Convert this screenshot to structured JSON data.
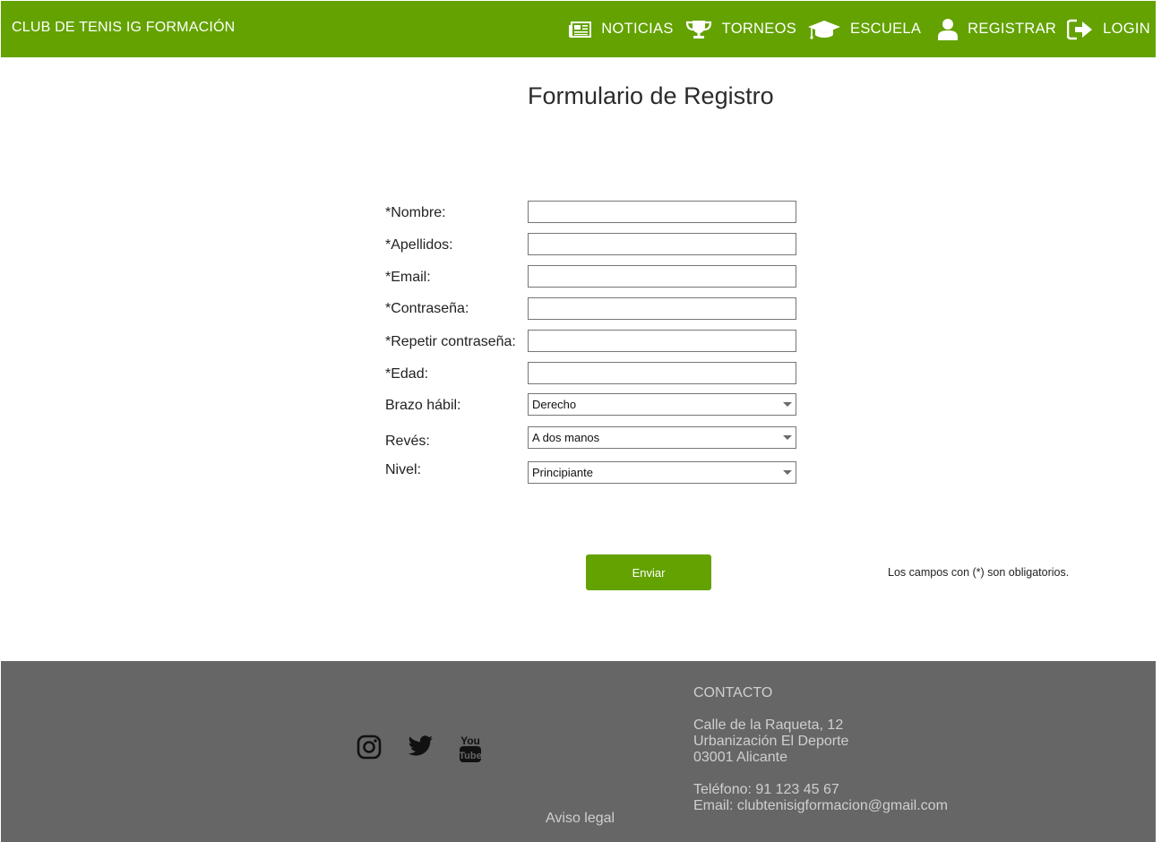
{
  "header": {
    "brand": "CLUB DE TENIS IG FORMACIÓN",
    "nav": [
      {
        "label": "NOTICIAS",
        "icon": "newspaper-icon"
      },
      {
        "label": "TORNEOS",
        "icon": "trophy-icon"
      },
      {
        "label": "ESCUELA",
        "icon": "graduation-cap-icon"
      },
      {
        "label": "REGISTRAR",
        "icon": "user-icon"
      },
      {
        "label": "LOGIN",
        "icon": "sign-in-icon"
      }
    ]
  },
  "main": {
    "title": "Formulario de Registro",
    "fields": {
      "nombre": {
        "label": "*Nombre:",
        "value": ""
      },
      "apellidos": {
        "label": "*Apellidos:",
        "value": ""
      },
      "email": {
        "label": "*Email:",
        "value": ""
      },
      "contrasena": {
        "label": "*Contraseña:",
        "value": ""
      },
      "repetir": {
        "label": "*Repetir contraseña:",
        "value": ""
      },
      "edad": {
        "label": "*Edad:",
        "value": ""
      },
      "brazo": {
        "label": "Brazo hábil:",
        "selected": "Derecho"
      },
      "reves": {
        "label": "Revés:",
        "selected": "A dos manos"
      },
      "nivel": {
        "label": "Nivel:",
        "selected": "Principiante"
      }
    },
    "submit_label": "Enviar",
    "required_note": "Los campos con (*) son obligatorios."
  },
  "footer": {
    "social": [
      {
        "icon": "instagram-icon"
      },
      {
        "icon": "twitter-icon"
      },
      {
        "icon": "youtube-icon"
      }
    ],
    "legal_link": "Aviso legal",
    "contact": {
      "heading": "CONTACTO",
      "address_line1": "Calle de la Raqueta, 12",
      "address_line2": "Urbanización El Deporte",
      "address_line3": "03001 Alicante",
      "phone": "Teléfono: 91 123 45 67",
      "email": "Email: clubtenisigformacion@gmail.com"
    }
  },
  "colors": {
    "brand_green": "#63a200",
    "footer_gray": "#666666"
  }
}
